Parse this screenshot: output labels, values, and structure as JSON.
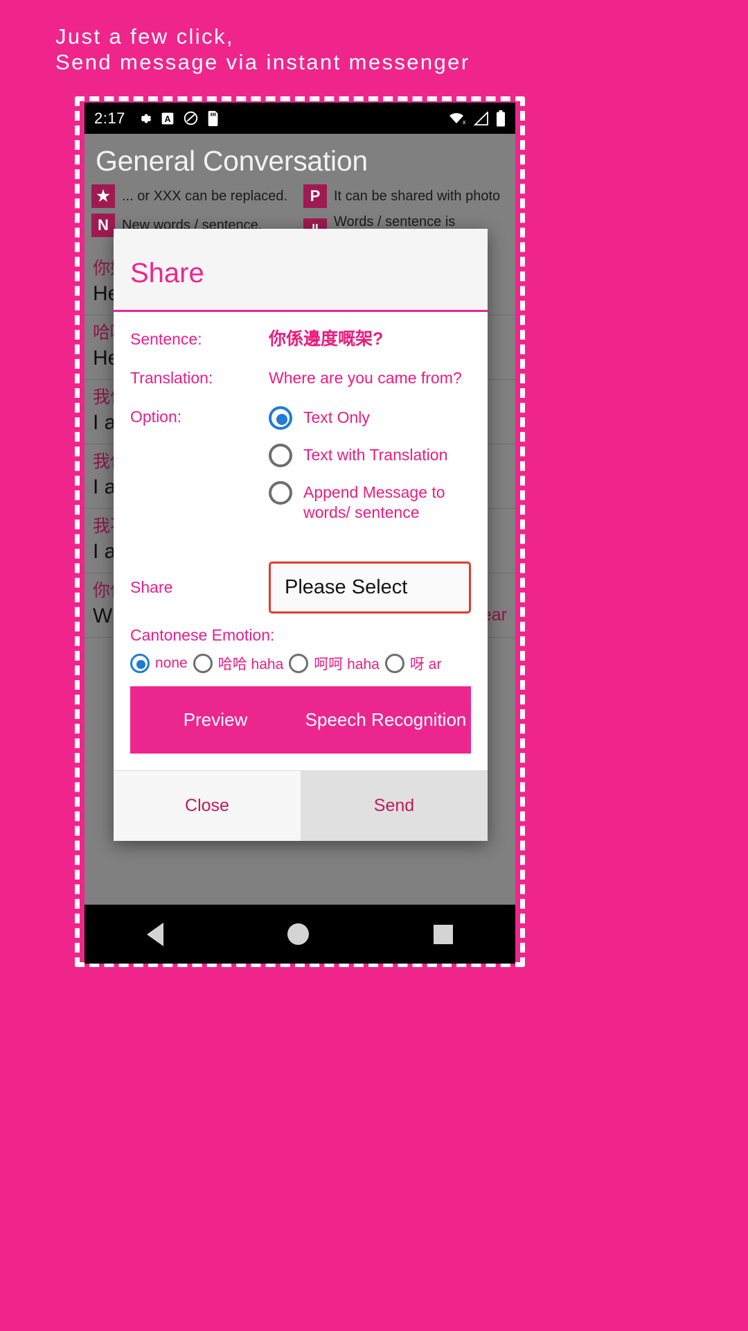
{
  "promo": {
    "line1": "Just a few click,",
    "line2": "Send message via instant messenger"
  },
  "colors": {
    "brand_pink": "#F0258C",
    "dialog_accent": "#EC268F",
    "radio_selected": "#1E7BD6",
    "spinner_border": "#E03C2E"
  },
  "statusbar": {
    "time": "2:17",
    "left_icons": [
      "gear-icon",
      "letter-a-icon",
      "do-not-disturb-icon",
      "sd-card-icon"
    ],
    "right_icons": [
      "wifi-off-icon",
      "signal-icon",
      "battery-icon"
    ]
  },
  "app": {
    "title": "General Conversation",
    "legend": [
      {
        "badge": "★",
        "text": "... or XXX can be replaced."
      },
      {
        "badge": "P",
        "text": "It can be shared with photo"
      },
      {
        "badge": "N",
        "text": "New words / sentence."
      },
      {
        "badge": "‖",
        "text": "Words / sentence is updated."
      }
    ],
    "conversation": [
      {
        "cn": "你好",
        "en": "Hello",
        "hear": ""
      },
      {
        "cn": "哈囉",
        "en": "Hello",
        "hear": ""
      },
      {
        "cn": "我係",
        "en": "I am",
        "hear": ""
      },
      {
        "cn": "我係",
        "en": "I am",
        "hear": ""
      },
      {
        "cn": "我不",
        "en": "I am",
        "hear": ""
      },
      {
        "cn": "你係",
        "en": "Where are you came from?",
        "hear": "Hear"
      }
    ]
  },
  "dialog": {
    "title": "Share",
    "sentence_label": "Sentence:",
    "sentence_value": "你係邊度嘅架?",
    "translation_label": "Translation:",
    "translation_value": "Where are you came from?",
    "option_label": "Option:",
    "options": [
      {
        "label": "Text Only",
        "selected": true
      },
      {
        "label": "Text with Translation",
        "selected": false
      },
      {
        "label": "Append Message to words/ sentence",
        "selected": false
      }
    ],
    "share_label": "Share",
    "share_value": "Please Select",
    "emotion_label": "Cantonese Emotion:",
    "emotions": [
      {
        "label": "none",
        "selected": true
      },
      {
        "label": "哈哈 haha",
        "selected": false
      },
      {
        "label": "呵呵 haha",
        "selected": false
      },
      {
        "label": "呀 ar",
        "selected": false
      }
    ],
    "preview_label": "Preview",
    "speech_label": "Speech Recognition",
    "close_label": "Close",
    "send_label": "Send"
  },
  "navbar": {
    "back": "back-icon",
    "home": "home-icon",
    "recents": "recents-icon"
  }
}
